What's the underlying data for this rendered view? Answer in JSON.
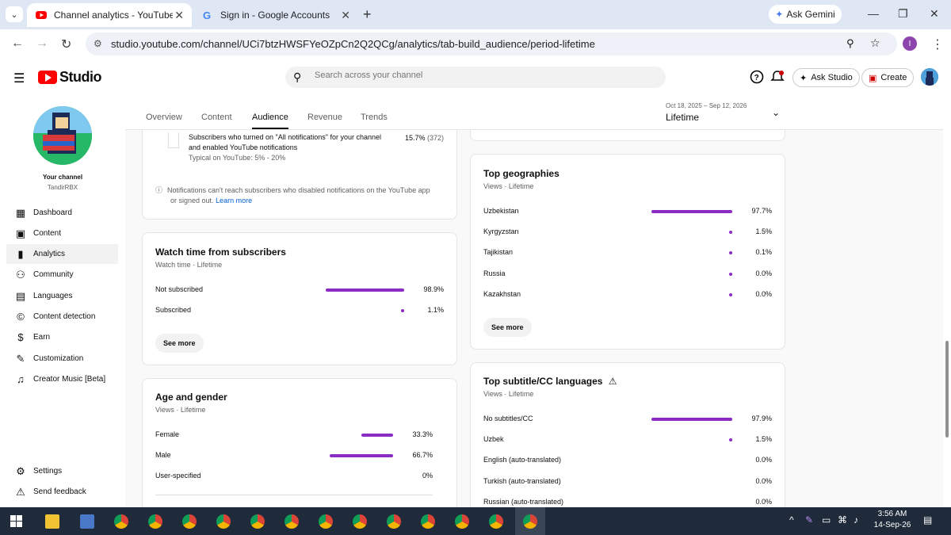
{
  "browser": {
    "tabs": [
      {
        "title": "Channel analytics - YouTube Stu",
        "active": true
      },
      {
        "title": "Sign in - Google Accounts",
        "active": false
      }
    ],
    "ask_gemini": "Ask Gemini",
    "url": "studio.youtube.com/channel/UCi7btzHWSFYeOZpCn2Q2QCg/analytics/tab-build_audience/period-lifetime",
    "profile_initial": "I"
  },
  "header": {
    "studio": "Studio",
    "search_placeholder": "Search across your channel",
    "ask_studio": "Ask Studio",
    "create": "Create"
  },
  "sidebar": {
    "your_channel": "Your channel",
    "channel_name": "TandirRBX",
    "items": [
      {
        "label": "Dashboard",
        "icon": "dashboard-icon"
      },
      {
        "label": "Content",
        "icon": "content-icon"
      },
      {
        "label": "Analytics",
        "icon": "analytics-icon",
        "active": true
      },
      {
        "label": "Community",
        "icon": "community-icon"
      },
      {
        "label": "Languages",
        "icon": "languages-icon"
      },
      {
        "label": "Content detection",
        "icon": "copyright-icon"
      },
      {
        "label": "Earn",
        "icon": "earn-icon"
      },
      {
        "label": "Customization",
        "icon": "customization-icon"
      },
      {
        "label": "Creator Music [Beta]",
        "icon": "music-icon"
      }
    ],
    "settings": "Settings",
    "feedback": "Send feedback"
  },
  "tabs": {
    "overview": "Overview",
    "content": "Content",
    "audience": "Audience",
    "revenue": "Revenue",
    "trends": "Trends"
  },
  "period": {
    "range": "Oct 18, 2025 – Sep 12, 2026",
    "label": "Lifetime"
  },
  "notifications_card": {
    "line1": "Subscribers who turned on \"All notifications\" for your channel",
    "line2": "and enabled YouTube notifications",
    "typical": "Typical on YouTube: 5% - 20%",
    "value": "15.7%",
    "count": "(372)",
    "info1": "Notifications can't reach subscribers who disabled notifications on the YouTube app",
    "info2": "or signed out.",
    "learn_more": "Learn more"
  },
  "watch_time": {
    "title": "Watch time from subscribers",
    "sub": "Watch time · Lifetime",
    "rows": [
      {
        "label": "Not subscribed",
        "value": "98.9%",
        "fraction": 0.989
      },
      {
        "label": "Subscribed",
        "value": "1.1%",
        "fraction": 0.011
      }
    ],
    "see_more": "See more"
  },
  "age_gender": {
    "title": "Age and gender",
    "sub": "Views · Lifetime",
    "rows": [
      {
        "label": "Female",
        "value": "33.3%",
        "fraction": 0.333
      },
      {
        "label": "Male",
        "value": "66.7%",
        "fraction": 0.667
      },
      {
        "label": "User-specified",
        "value": "0%",
        "fraction": 0
      }
    ]
  },
  "geographies": {
    "title": "Top geographies",
    "sub": "Views · Lifetime",
    "rows": [
      {
        "label": "Uzbekistan",
        "value": "97.7%",
        "fraction": 0.977
      },
      {
        "label": "Kyrgyzstan",
        "value": "1.5%",
        "fraction": 0.015
      },
      {
        "label": "Tajikistan",
        "value": "0.1%",
        "fraction": 0.001
      },
      {
        "label": "Russia",
        "value": "0.0%",
        "fraction": 0.0
      },
      {
        "label": "Kazakhstan",
        "value": "0.0%",
        "fraction": 0.0
      }
    ],
    "see_more": "See more"
  },
  "subtitles": {
    "title": "Top subtitle/CC languages",
    "sub": "Views · Lifetime",
    "rows": [
      {
        "label": "No subtitles/CC",
        "value": "97.9%",
        "fraction": 0.979
      },
      {
        "label": "Uzbek",
        "value": "1.5%",
        "fraction": 0.015
      },
      {
        "label": "English (auto-translated)",
        "value": "0.0%",
        "fraction": 0
      },
      {
        "label": "Turkish (auto-translated)",
        "value": "0.0%",
        "fraction": 0
      },
      {
        "label": "Russian (auto-translated)",
        "value": "0.0%",
        "fraction": 0
      }
    ]
  },
  "taskbar": {
    "time": "3:56 AM",
    "date": "14-Sep-26"
  },
  "colors": {
    "bar": "#8a2bc3",
    "accent": "#ff0000"
  }
}
